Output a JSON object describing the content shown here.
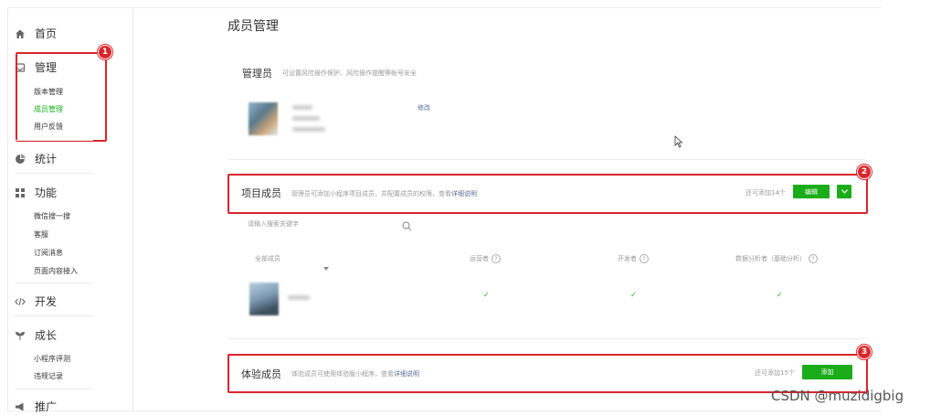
{
  "sidebar": {
    "items": [
      {
        "label": "首页",
        "icon": "home-icon"
      },
      {
        "label": "管理",
        "icon": "inbox-icon"
      },
      {
        "label": "统计",
        "icon": "pie-chart-icon"
      },
      {
        "label": "功能",
        "icon": "grid-icon"
      },
      {
        "label": "开发",
        "icon": "code-icon"
      },
      {
        "label": "成长",
        "icon": "sprout-icon"
      },
      {
        "label": "推广",
        "icon": "megaphone-icon"
      }
    ],
    "manage_sub": [
      "版本管理",
      "成员管理",
      "用户反馈"
    ],
    "feature_sub": [
      "微信搜一搜",
      "客服",
      "订阅消息",
      "页面内容接入"
    ],
    "growth_sub": [
      "小程序评测",
      "违规记录"
    ]
  },
  "main": {
    "title": "成员管理",
    "admin": {
      "title": "管理员",
      "desc": "可设置风险操作保护、风险操作提醒等帐号安全",
      "edit_link": "修改"
    },
    "project": {
      "title": "项目成员",
      "desc": "管理员可添加小程序项目成员，并配置成员的权限，查看",
      "desc_link": "详细说明",
      "count": "还可添加14个",
      "edit_button": "编辑",
      "search_placeholder": "请输入搜索关键字",
      "columns": [
        "全部成员",
        "运营者",
        "开发者",
        "数据分析者（基础分析）"
      ]
    },
    "trial": {
      "title": "体验成员",
      "desc": "体验成员可使用体验版小程序，查看",
      "desc_link": "详细说明",
      "count": "还可添加15个",
      "add_button": "添加"
    }
  },
  "annotations": [
    "1",
    "2",
    "3"
  ],
  "watermark": "CSDN @muzidigbig",
  "colors": {
    "accent": "#1aad19",
    "annotation": "#d9262c",
    "link": "#576b95"
  }
}
